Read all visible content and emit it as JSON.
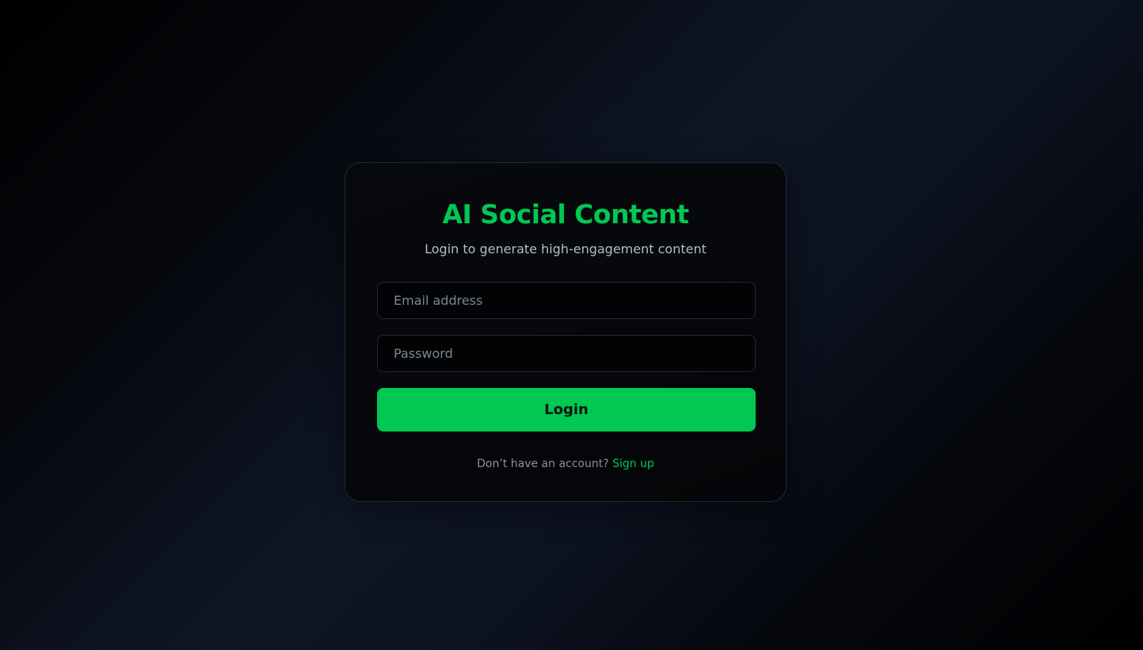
{
  "login": {
    "title": "AI Social Content",
    "subtitle": "Login to generate high-engagement content",
    "email_placeholder": "Email address",
    "email_value": "",
    "password_placeholder": "Password",
    "password_value": "",
    "login_label": "Login",
    "signup_prompt": "Don’t have an account?",
    "signup_link": "Sign up"
  },
  "colors": {
    "accent": "#00c853",
    "card_background": "#06080b",
    "card_border": "#232a36",
    "text_muted": "#8a909c"
  }
}
